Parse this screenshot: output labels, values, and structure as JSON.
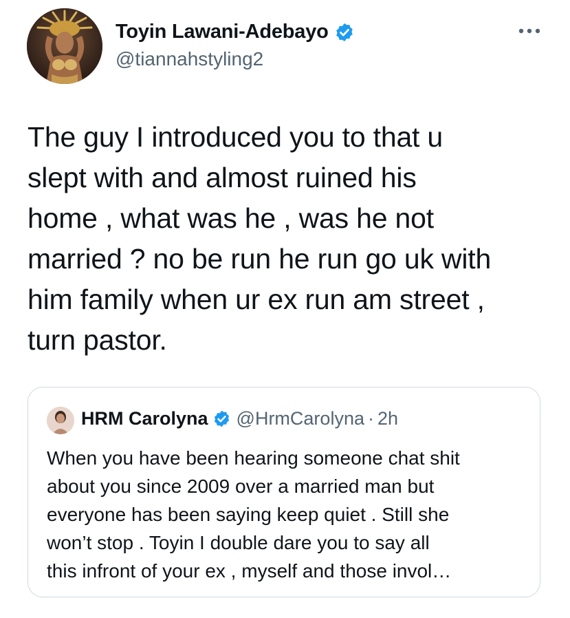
{
  "tweet": {
    "author": {
      "name": "Toyin Lawani-Adebayo",
      "handle": "@tiannahstyling2",
      "verified": true
    },
    "more_icon": "more-horizontal-icon",
    "text": "The guy I introduced you to that u\nslept with and almost ruined his\nhome , what was he , was he not\nmarried ? no be run he run go uk with\nhim family when ur ex run am street ,\nturn pastor."
  },
  "quote": {
    "author": {
      "name": "HRM Carolyna",
      "handle": "@HrmCarolyna",
      "verified": true
    },
    "separator": "·",
    "time": "2h",
    "text": "When you have been hearing someone chat shit\nabout you since 2009 over a married man but\neveryone has been saying keep quiet . Still she\nwon’t stop . Toyin I double dare you to say all\nthis infront of your ex  , myself and those invol…"
  },
  "colors": {
    "verified_blue": "#1d9bf0",
    "text_primary": "#0f1419",
    "text_secondary": "#536471",
    "border": "#cfd9de"
  }
}
